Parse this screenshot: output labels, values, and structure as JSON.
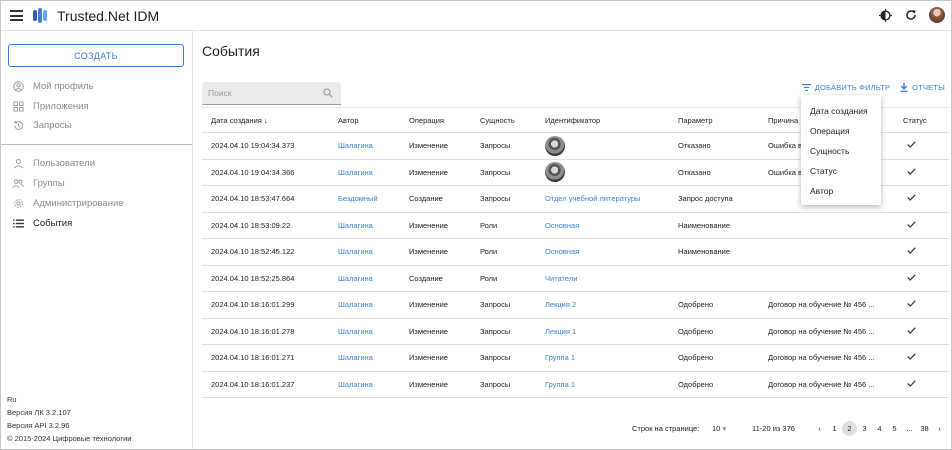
{
  "app": {
    "title": "Trusted.Net IDM"
  },
  "sidebar": {
    "create_label": "СОЗДАТЬ",
    "items": [
      {
        "label": "Мой профиль"
      },
      {
        "label": "Приложения"
      },
      {
        "label": "Запросы"
      },
      {
        "label": "Пользователи"
      },
      {
        "label": "Группы"
      },
      {
        "label": "Администрирование"
      },
      {
        "label": "События"
      }
    ],
    "footer": {
      "lang": "Ru",
      "version_lk": "Версия ЛК 3.2.107",
      "version_api": "Версия API 3.2.96",
      "copyright": "© 2015-2024 Цифровые технологии"
    }
  },
  "main": {
    "title": "События",
    "search_placeholder": "Поиск",
    "add_filter_label": "ДОБАВИТЬ ФИЛЬТР",
    "reports_label": "ОТЧЕТЫ",
    "columns": [
      "Дата создания",
      "Автор",
      "Операция",
      "Сущность",
      "Идентификатор",
      "Параметр",
      "Причина",
      "Статус"
    ],
    "rows": [
      {
        "date": "2024.04.10 19:04:34.373",
        "author": "Шалагина",
        "operation": "Изменение",
        "entity": "Запросы",
        "identifier": "",
        "parameter": "Отказано",
        "reason": "Ошибка в"
      },
      {
        "date": "2024.04.10 19:04:34.366",
        "author": "Шалагина",
        "operation": "Изменение",
        "entity": "Запросы",
        "identifier": "",
        "parameter": "Отказано",
        "reason": "Ошибка в"
      },
      {
        "date": "2024.04.10 18:53:47.664",
        "author": "Бездомный",
        "operation": "Создание",
        "entity": "Запросы",
        "identifier": "Отдел учебной литературы",
        "parameter": "Запрос доступа",
        "reason": ""
      },
      {
        "date": "2024.04.10 18:53:09.22",
        "author": "Шалагина",
        "operation": "Изменение",
        "entity": "Роли",
        "identifier": "Основная",
        "parameter": "Наименование",
        "reason": ""
      },
      {
        "date": "2024.04.10 18:52:45.122",
        "author": "Шалагина",
        "operation": "Изменение",
        "entity": "Роли",
        "identifier": "Основная",
        "parameter": "Наименование",
        "reason": ""
      },
      {
        "date": "2024.04.10 18:52:25.864",
        "author": "Шалагина",
        "operation": "Создание",
        "entity": "Роли",
        "identifier": "Читатели",
        "parameter": "",
        "reason": ""
      },
      {
        "date": "2024.04.10 18:16:01.299",
        "author": "Шалагина",
        "operation": "Изменение",
        "entity": "Запросы",
        "identifier": "Лекция 2",
        "parameter": "Одобрено",
        "reason": "Договор на обучение № 456 ..."
      },
      {
        "date": "2024.04.10 18:16:01.278",
        "author": "Шалагина",
        "operation": "Изменение",
        "entity": "Запросы",
        "identifier": "Лекция 1",
        "parameter": "Одобрено",
        "reason": "Договор на обучение № 456 ..."
      },
      {
        "date": "2024.04.10 18:16:01.271",
        "author": "Шалагина",
        "operation": "Изменение",
        "entity": "Запросы",
        "identifier": "Группа 1",
        "parameter": "Одобрено",
        "reason": "Договор на обучение № 456 ..."
      },
      {
        "date": "2024.04.10 18:16:01.237",
        "author": "Шалагина",
        "operation": "Изменение",
        "entity": "Запросы",
        "identifier": "Группа 1",
        "parameter": "Одобрено",
        "reason": "Договор на обучение № 456 ..."
      }
    ],
    "filter_menu": [
      "Дата создания",
      "Операция",
      "Сущность",
      "Статус",
      "Автор"
    ],
    "pagination": {
      "rows_label": "Строк на странице:",
      "rows_value": "10",
      "range": "11-20 из 376",
      "pages": [
        "1",
        "2",
        "3",
        "4",
        "5",
        "...",
        "38"
      ],
      "current": "2"
    }
  },
  "colors": {
    "accent": "#3b7fd4"
  },
  "icons": [
    "menu-icon",
    "logo-icon",
    "theme-icon",
    "refresh-icon",
    "user-avatar",
    "profile-icon",
    "apps-icon",
    "history-icon",
    "users-icon",
    "groups-icon",
    "settings-icon",
    "events-icon",
    "search-icon",
    "filter-icon",
    "download-icon",
    "sort-arrow-icon",
    "check-icon"
  ]
}
